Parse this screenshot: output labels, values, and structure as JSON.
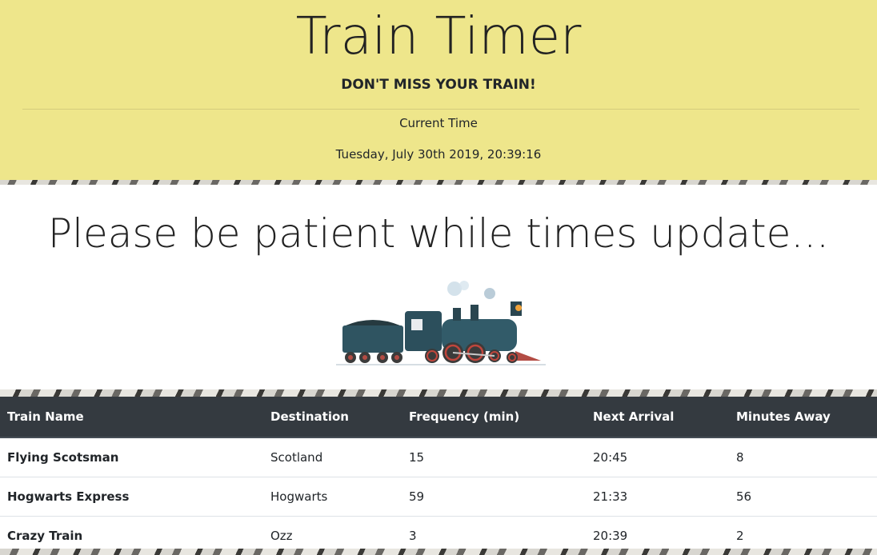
{
  "header": {
    "title": "Train Timer",
    "tagline": "DON'T MISS YOUR TRAIN!",
    "current_time_label": "Current Time",
    "current_time_value": "Tuesday, July 30th 2019, 20:39:16"
  },
  "banner": {
    "message": "Please be patient while times update..."
  },
  "table": {
    "columns": [
      "Train Name",
      "Destination",
      "Frequency (min)",
      "Next Arrival",
      "Minutes Away"
    ],
    "rows": [
      {
        "name": "Flying Scotsman",
        "destination": "Scotland",
        "frequency": "15",
        "next_arrival": "20:45",
        "minutes_away": "8"
      },
      {
        "name": "Hogwarts Express",
        "destination": "Hogwarts",
        "frequency": "59",
        "next_arrival": "21:33",
        "minutes_away": "56"
      },
      {
        "name": "Crazy Train",
        "destination": "Ozz",
        "frequency": "3",
        "next_arrival": "20:39",
        "minutes_away": "2"
      }
    ]
  },
  "colors": {
    "jumbotron": "#eee68b",
    "table_header": "#343a40"
  }
}
